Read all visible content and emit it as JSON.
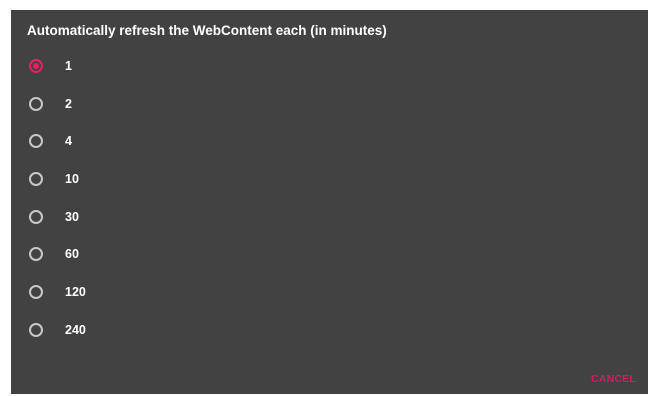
{
  "dialog": {
    "title": "Automatically refresh the WebContent each (in minutes)",
    "options": [
      {
        "label": "1",
        "selected": true
      },
      {
        "label": "2",
        "selected": false
      },
      {
        "label": "4",
        "selected": false
      },
      {
        "label": "10",
        "selected": false
      },
      {
        "label": "30",
        "selected": false
      },
      {
        "label": "60",
        "selected": false
      },
      {
        "label": "120",
        "selected": false
      },
      {
        "label": "240",
        "selected": false
      }
    ],
    "cancel_label": "CANCEL"
  },
  "colors": {
    "dialog_background": "#424242",
    "accent": "#e91e63",
    "radio_unchecked": "#c8c8c8",
    "text": "#ffffff"
  }
}
